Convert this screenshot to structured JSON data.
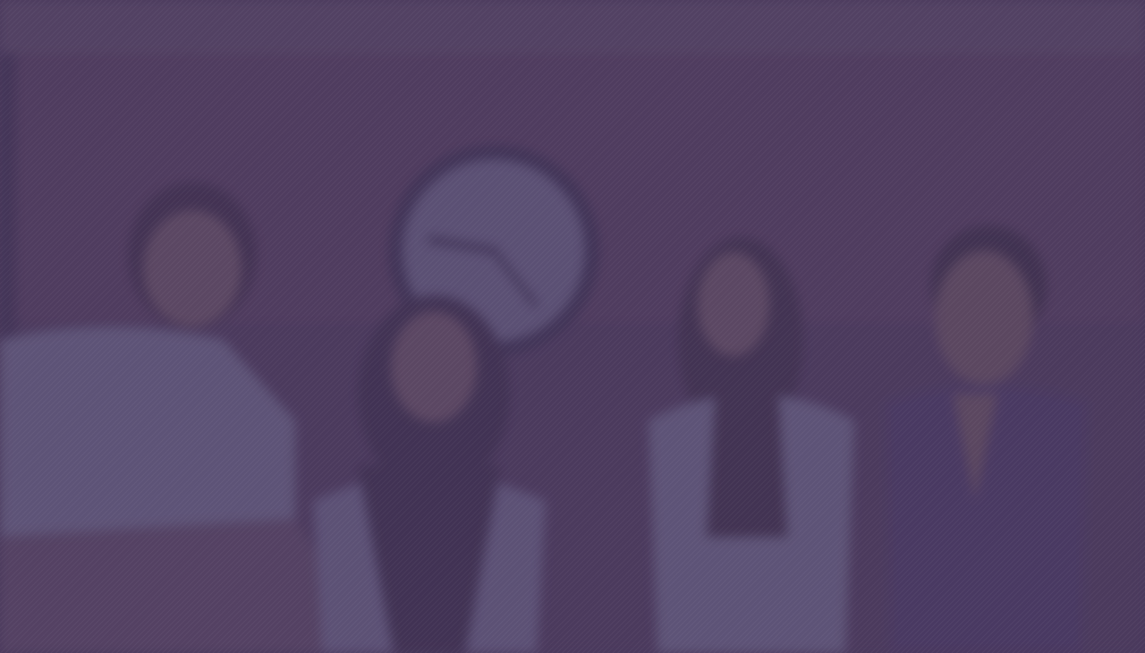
{
  "hero": {
    "colors": {
      "overlay": "#4a3860",
      "wall": "#55405f",
      "clock_rim": "#3a3150",
      "clock_face": "#6a6485"
    },
    "clock": {
      "icon": "wall-clock-icon"
    }
  }
}
